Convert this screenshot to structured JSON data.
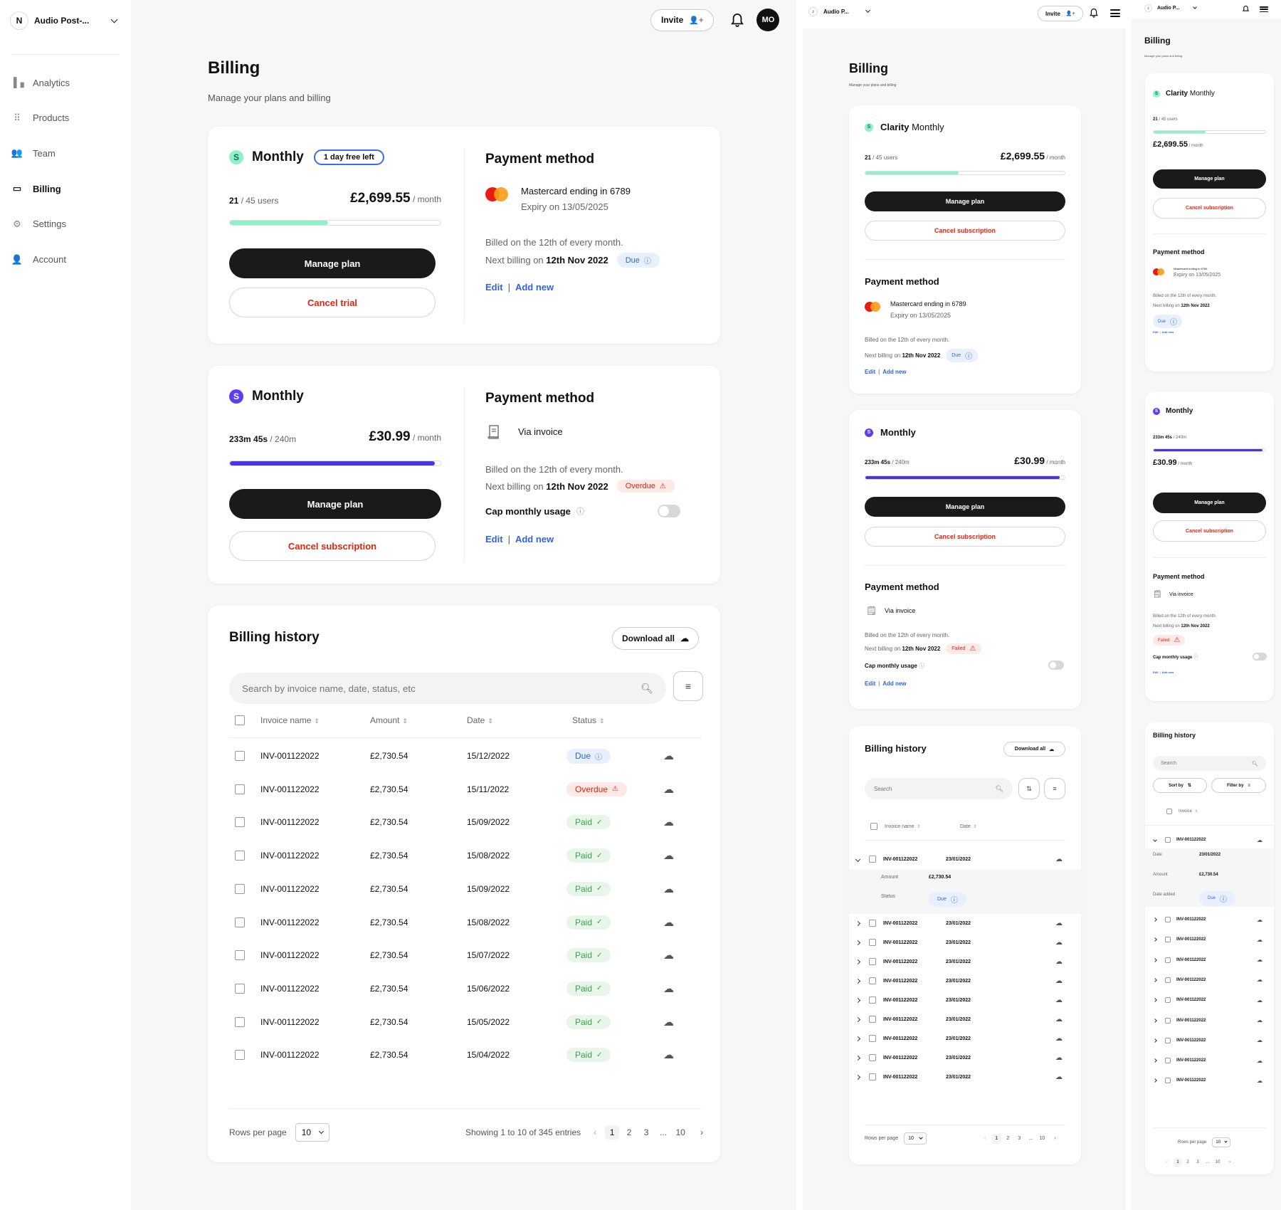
{
  "workspace": {
    "initial": "N",
    "name": "Audio Post-...",
    "name_short": "Audio P..."
  },
  "sidebar": {
    "items": [
      {
        "label": "Analytics",
        "icon": "bar-chart-icon",
        "glyph": "▐▗"
      },
      {
        "label": "Products",
        "icon": "grid-icon",
        "glyph": "⠿"
      },
      {
        "label": "Team",
        "icon": "people-icon",
        "glyph": "👥"
      },
      {
        "label": "Billing",
        "icon": "credit-card-icon",
        "glyph": "▭",
        "active": true
      },
      {
        "label": "Settings",
        "icon": "gear-icon",
        "glyph": "⚙"
      },
      {
        "label": "Account",
        "icon": "person-icon",
        "glyph": "👤"
      }
    ]
  },
  "header": {
    "invite_label": "Invite",
    "avatar_initials": "MO"
  },
  "page": {
    "title": "Billing",
    "subtitle": "Manage your plans and billing"
  },
  "plans": [
    {
      "brand": "Clarity",
      "title": "Monthly",
      "icon_color": "#8ef2c9",
      "trial_badge": "1 day free left",
      "usage_value": "21",
      "usage_total": "/ 45 users",
      "usage_fraction": 0.4667,
      "bar_color": "#8ef2c9",
      "price": "£2,699.55",
      "price_unit": "/ month",
      "manage_label": "Manage plan",
      "cancel_label": "Cancel trial",
      "cancel_label_alt": "Cancel subscription",
      "payment": {
        "title": "Payment method",
        "type": "card",
        "line1": "Mastercard ending in 6789",
        "line2": "Expiry on 13/05/2025",
        "billed": "Billed on the 12th of every month.",
        "next_prefix": "Next billing on",
        "next_date": "12th Nov 2022",
        "status": "Due",
        "edit": "Edit",
        "add_new": "Add new"
      }
    },
    {
      "title": "Monthly",
      "icon_color": "#5b3df5",
      "usage_value": "233m 45s",
      "usage_total": "/ 240m",
      "usage_fraction": 0.974,
      "bar_color": "#4a32e6",
      "price": "£30.99",
      "price_unit": "/ month",
      "manage_label": "Manage plan",
      "cancel_label": "Cancel subscription",
      "payment": {
        "title": "Payment method",
        "type": "invoice",
        "line1": "Via invoice",
        "billed": "Billed on the 12th of every month.",
        "next_prefix": "Next billing on",
        "next_date": "12th Nov 2022",
        "status": "Overdue",
        "status_alt": "Failed",
        "cap_label": "Cap monthly usage",
        "cap_enabled": false,
        "edit": "Edit",
        "add_new": "Add new"
      }
    }
  ],
  "history": {
    "title": "Billing history",
    "download_all": "Download all",
    "search_placeholder": "Search by invoice name, date, status, etc",
    "search_placeholder_short": "Search",
    "sort_by": "Sort by",
    "filter_by": "Filter by",
    "columns": [
      "Invoice name",
      "Amount",
      "Date",
      "Status"
    ],
    "mobile_column": "Invoice",
    "rows": [
      {
        "name": "INV-001122022",
        "amount": "£2,730.54",
        "date": "15/12/2022",
        "status": "Due"
      },
      {
        "name": "INV-001122022",
        "amount": "£2,730.54",
        "date": "15/11/2022",
        "status": "Overdue"
      },
      {
        "name": "INV-001122022",
        "amount": "£2,730.54",
        "date": "15/09/2022",
        "status": "Paid"
      },
      {
        "name": "INV-001122022",
        "amount": "£2,730.54",
        "date": "15/08/2022",
        "status": "Paid"
      },
      {
        "name": "INV-001122022",
        "amount": "£2,730.54",
        "date": "15/09/2022",
        "status": "Paid"
      },
      {
        "name": "INV-001122022",
        "amount": "£2,730.54",
        "date": "15/08/2022",
        "status": "Paid"
      },
      {
        "name": "INV-001122022",
        "amount": "£2,730.54",
        "date": "15/07/2022",
        "status": "Paid"
      },
      {
        "name": "INV-001122022",
        "amount": "£2,730.54",
        "date": "15/06/2022",
        "status": "Paid"
      },
      {
        "name": "INV-001122022",
        "amount": "£2,730.54",
        "date": "15/05/2022",
        "status": "Paid"
      },
      {
        "name": "INV-001122022",
        "amount": "£2,730.54",
        "date": "15/04/2022",
        "status": "Paid"
      }
    ],
    "compact_rows": {
      "name": "INV-001122022",
      "date": "23/01/2022",
      "amount": "£2,730.54",
      "status": "Due",
      "count": 9,
      "expanded_labels": {
        "amount": "Amount",
        "status": "Status",
        "date": "Date",
        "date_added": "Date added"
      }
    },
    "rows_per_page_label": "Rows per page",
    "rows_per_page": "10",
    "showing": "Showing 1 to 10 of 345 entries",
    "pages": [
      "1",
      "2",
      "3",
      "...",
      "10"
    ],
    "current_page": "1"
  },
  "colors": {
    "accent_blue": "#2f63e6",
    "danger": "#e0240f",
    "success": "#3aa24d",
    "mint": "#8ef2c9",
    "purple": "#4a32e6"
  }
}
